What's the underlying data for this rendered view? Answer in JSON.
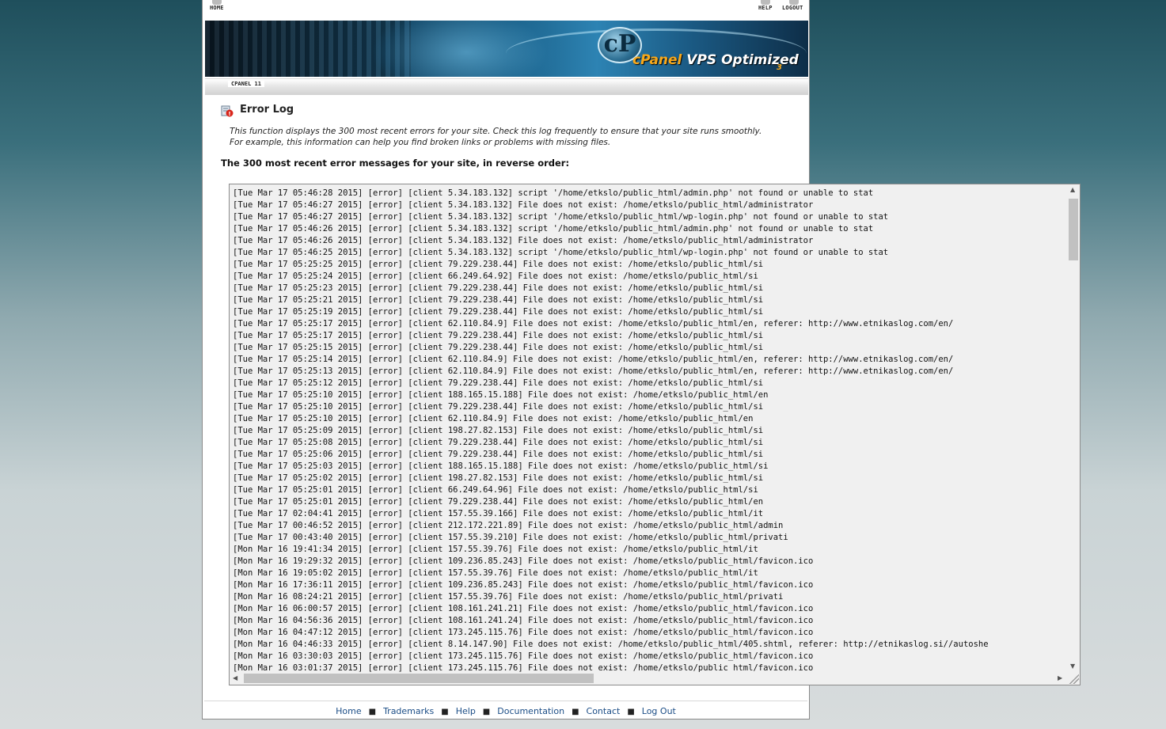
{
  "topnav": {
    "home": "HOME",
    "help": "HELP",
    "logout": "LOGOUT"
  },
  "banner": {
    "logo_letter": "cP",
    "brand": "cPanel",
    "product": " VPS Optimized",
    "version": "3"
  },
  "breadcrumb": "CPANEL 11",
  "page": {
    "title": "Error Log",
    "description": "This function displays the 300 most recent errors for your site. Check this log frequently to ensure that your site runs smoothly. For example, this information can help you find broken links or problems with missing files.",
    "subtitle": "The 300 most recent error messages for your site, in reverse order:"
  },
  "log_lines": [
    "[Tue Mar 17 05:46:28 2015] [error] [client 5.34.183.132] script '/home/etkslo/public_html/admin.php' not found or unable to stat",
    "[Tue Mar 17 05:46:27 2015] [error] [client 5.34.183.132] File does not exist: /home/etkslo/public_html/administrator",
    "[Tue Mar 17 05:46:27 2015] [error] [client 5.34.183.132] script '/home/etkslo/public_html/wp-login.php' not found or unable to stat",
    "[Tue Mar 17 05:46:26 2015] [error] [client 5.34.183.132] script '/home/etkslo/public_html/admin.php' not found or unable to stat",
    "[Tue Mar 17 05:46:26 2015] [error] [client 5.34.183.132] File does not exist: /home/etkslo/public_html/administrator",
    "[Tue Mar 17 05:46:25 2015] [error] [client 5.34.183.132] script '/home/etkslo/public_html/wp-login.php' not found or unable to stat",
    "[Tue Mar 17 05:25:25 2015] [error] [client 79.229.238.44] File does not exist: /home/etkslo/public_html/si",
    "[Tue Mar 17 05:25:24 2015] [error] [client 66.249.64.92] File does not exist: /home/etkslo/public_html/si",
    "[Tue Mar 17 05:25:23 2015] [error] [client 79.229.238.44] File does not exist: /home/etkslo/public_html/si",
    "[Tue Mar 17 05:25:21 2015] [error] [client 79.229.238.44] File does not exist: /home/etkslo/public_html/si",
    "[Tue Mar 17 05:25:19 2015] [error] [client 79.229.238.44] File does not exist: /home/etkslo/public_html/si",
    "[Tue Mar 17 05:25:17 2015] [error] [client 62.110.84.9] File does not exist: /home/etkslo/public_html/en, referer: http://www.etnikaslog.com/en/",
    "[Tue Mar 17 05:25:17 2015] [error] [client 79.229.238.44] File does not exist: /home/etkslo/public_html/si",
    "[Tue Mar 17 05:25:15 2015] [error] [client 79.229.238.44] File does not exist: /home/etkslo/public_html/si",
    "[Tue Mar 17 05:25:14 2015] [error] [client 62.110.84.9] File does not exist: /home/etkslo/public_html/en, referer: http://www.etnikaslog.com/en/",
    "[Tue Mar 17 05:25:13 2015] [error] [client 62.110.84.9] File does not exist: /home/etkslo/public_html/en, referer: http://www.etnikaslog.com/en/",
    "[Tue Mar 17 05:25:12 2015] [error] [client 79.229.238.44] File does not exist: /home/etkslo/public_html/si",
    "[Tue Mar 17 05:25:10 2015] [error] [client 188.165.15.188] File does not exist: /home/etkslo/public_html/en",
    "[Tue Mar 17 05:25:10 2015] [error] [client 79.229.238.44] File does not exist: /home/etkslo/public_html/si",
    "[Tue Mar 17 05:25:10 2015] [error] [client 62.110.84.9] File does not exist: /home/etkslo/public_html/en",
    "[Tue Mar 17 05:25:09 2015] [error] [client 198.27.82.153] File does not exist: /home/etkslo/public_html/si",
    "[Tue Mar 17 05:25:08 2015] [error] [client 79.229.238.44] File does not exist: /home/etkslo/public_html/si",
    "[Tue Mar 17 05:25:06 2015] [error] [client 79.229.238.44] File does not exist: /home/etkslo/public_html/si",
    "[Tue Mar 17 05:25:03 2015] [error] [client 188.165.15.188] File does not exist: /home/etkslo/public_html/si",
    "[Tue Mar 17 05:25:02 2015] [error] [client 198.27.82.153] File does not exist: /home/etkslo/public_html/si",
    "[Tue Mar 17 05:25:01 2015] [error] [client 66.249.64.96] File does not exist: /home/etkslo/public_html/si",
    "[Tue Mar 17 05:25:01 2015] [error] [client 79.229.238.44] File does not exist: /home/etkslo/public_html/en",
    "[Tue Mar 17 02:04:41 2015] [error] [client 157.55.39.166] File does not exist: /home/etkslo/public_html/it",
    "[Tue Mar 17 00:46:52 2015] [error] [client 212.172.221.89] File does not exist: /home/etkslo/public_html/admin",
    "[Tue Mar 17 00:43:40 2015] [error] [client 157.55.39.210] File does not exist: /home/etkslo/public_html/privati",
    "[Mon Mar 16 19:41:34 2015] [error] [client 157.55.39.76] File does not exist: /home/etkslo/public_html/it",
    "[Mon Mar 16 19:29:32 2015] [error] [client 109.236.85.243] File does not exist: /home/etkslo/public_html/favicon.ico",
    "[Mon Mar 16 19:05:02 2015] [error] [client 157.55.39.76] File does not exist: /home/etkslo/public_html/it",
    "[Mon Mar 16 17:36:11 2015] [error] [client 109.236.85.243] File does not exist: /home/etkslo/public_html/favicon.ico",
    "[Mon Mar 16 08:24:21 2015] [error] [client 157.55.39.76] File does not exist: /home/etkslo/public_html/privati",
    "[Mon Mar 16 06:00:57 2015] [error] [client 108.161.241.21] File does not exist: /home/etkslo/public_html/favicon.ico",
    "[Mon Mar 16 04:56:36 2015] [error] [client 108.161.241.24] File does not exist: /home/etkslo/public_html/favicon.ico",
    "[Mon Mar 16 04:47:12 2015] [error] [client 173.245.115.76] File does not exist: /home/etkslo/public_html/favicon.ico",
    "[Mon Mar 16 04:46:33 2015] [error] [client 8.14.147.90] File does not exist: /home/etkslo/public_html/405.shtml, referer: http://etnikaslog.si//autoshe",
    "[Mon Mar 16 03:30:03 2015] [error] [client 173.245.115.76] File does not exist: /home/etkslo/public_html/favicon.ico",
    "[Mon Mar 16 03:01:37 2015] [error] [client 173.245.115.76] File does not exist: /home/etkslo/public_html/favicon.ico"
  ],
  "footer": {
    "links": [
      "Home",
      "Trademarks",
      "Help",
      "Documentation",
      "Contact",
      "Log Out"
    ],
    "separator": "■"
  },
  "colors": {
    "link": "#1b4d86",
    "brand_orange": "#f7a81b"
  }
}
